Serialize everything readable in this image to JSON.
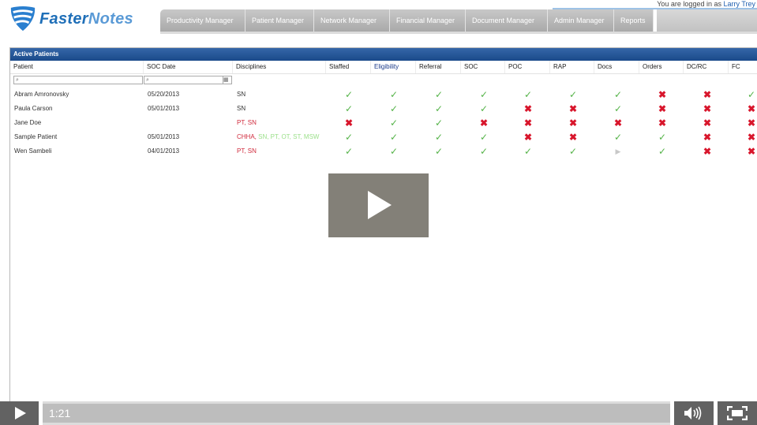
{
  "app": {
    "logo_text_a": "Faster",
    "logo_text_b": "Notes",
    "login_prefix": "You are logged in as",
    "login_user": "Larry Trey"
  },
  "nav": {
    "tabs": [
      "Productivity Manager",
      "Patient Manager",
      "Network Manager",
      "Financial Manager",
      "Document Manager",
      "Admin Manager",
      "Reports"
    ]
  },
  "panel": {
    "title": "Active Patients",
    "columns": [
      "Patient",
      "SOC Date",
      "Disciplines",
      "Staffed",
      "Eligibility",
      "Referral",
      "SOC",
      "POC",
      "RAP",
      "Docs",
      "Orders",
      "DC/RC",
      "FC"
    ],
    "filter_icon": "search-icon",
    "calendar_icon": "calendar-icon"
  },
  "patients": [
    {
      "name": "Abram Amronovsky",
      "soc": "05/20/2013",
      "disc_main": "SN",
      "disc_extra": "",
      "disc_style": "plain",
      "status": [
        "ok",
        "ok",
        "ok",
        "ok",
        "ok",
        "ok",
        "ok",
        "no",
        "no",
        "ok"
      ]
    },
    {
      "name": "Paula Carson",
      "soc": "05/01/2013",
      "disc_main": "SN",
      "disc_extra": "",
      "disc_style": "plain",
      "status": [
        "ok",
        "ok",
        "ok",
        "ok",
        "no",
        "no",
        "ok",
        "no",
        "no",
        "no"
      ]
    },
    {
      "name": "Jane Doe",
      "soc": "",
      "disc_main": "PT, SN",
      "disc_extra": "",
      "disc_style": "red",
      "status": [
        "no",
        "ok",
        "ok",
        "no",
        "no",
        "no",
        "no",
        "no",
        "no",
        "no"
      ]
    },
    {
      "name": "Sample Patient",
      "soc": "05/01/2013",
      "disc_main": "CHHA,",
      "disc_extra": " SN, PT, OT, ST, MSW",
      "disc_style": "mixed",
      "status": [
        "ok",
        "ok",
        "ok",
        "ok",
        "no",
        "no",
        "ok",
        "ok",
        "no",
        "no"
      ]
    },
    {
      "name": "Wen Sambeli",
      "soc": "04/01/2013",
      "disc_main": "PT, SN",
      "disc_extra": "",
      "disc_style": "red",
      "status": [
        "ok",
        "ok",
        "ok",
        "ok",
        "ok",
        "ok",
        "pend",
        "ok",
        "no",
        "no"
      ]
    }
  ],
  "player": {
    "time": "1:21",
    "play_icon": "play-icon",
    "volume_icon": "volume-icon",
    "fullscreen_icon": "fullscreen-icon"
  },
  "colors": {
    "ok": "#55b348",
    "no": "#d8162c",
    "header_blue": "#1a4a8a",
    "overlay": "#78756c"
  }
}
